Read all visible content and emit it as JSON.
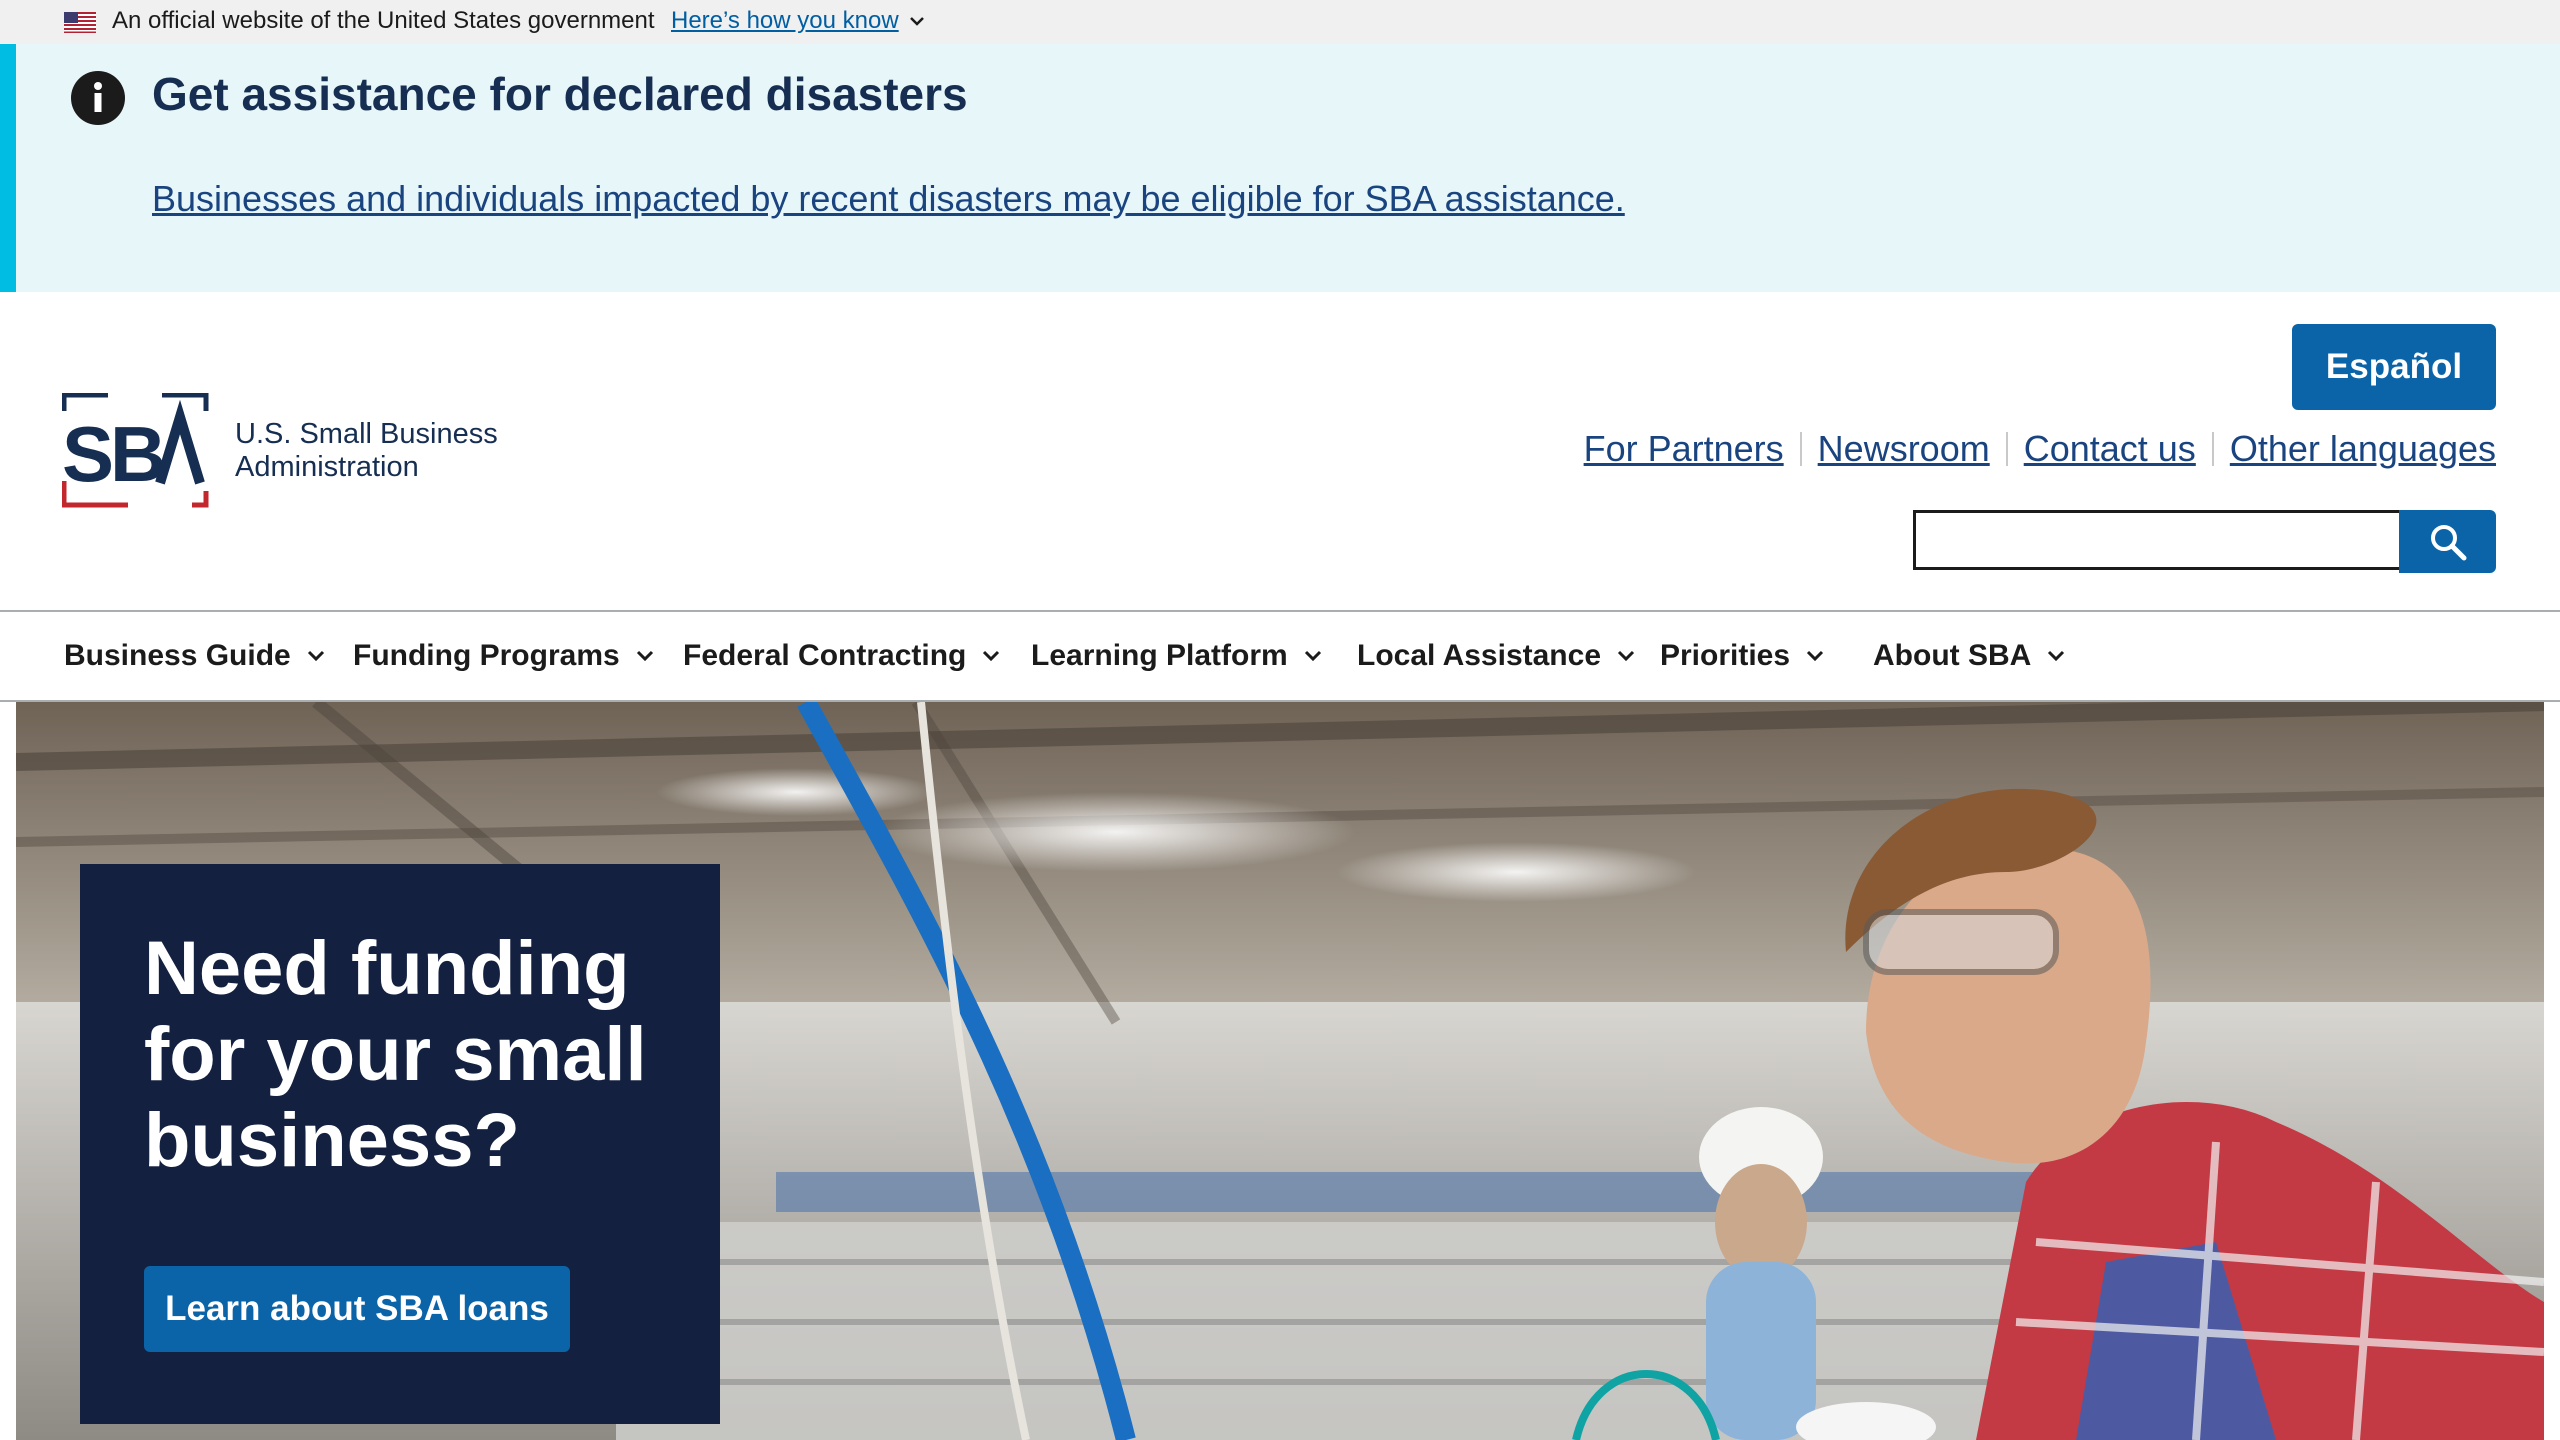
{
  "gov_banner": {
    "text": "An official website of the United States government",
    "link": "Here’s how you know"
  },
  "alert": {
    "heading": "Get assistance for declared disasters",
    "link": "Businesses and individuals impacted by recent disasters may be eligible for SBA assistance."
  },
  "header": {
    "logo_text_line1": "U.S. Small Business",
    "logo_text_line2": "Administration",
    "espanol_label": "Español",
    "util_links": [
      "For Partners",
      "Newsroom",
      "Contact us",
      "Other languages"
    ],
    "search_placeholder": ""
  },
  "nav": {
    "items": [
      "Business Guide",
      "Funding Programs",
      "Federal Contracting",
      "Learning Platform",
      "Local Assistance",
      "Priorities",
      "About SBA"
    ]
  },
  "hero": {
    "title": "Need funding for your small business?",
    "button_label": "Learn about SBA loans"
  },
  "colors": {
    "primary": "#0b64a8",
    "navy": "#162e51",
    "hero_card": "#13203f",
    "alert_bg": "#e7f6f8",
    "alert_bar": "#00bde3"
  },
  "icons": [
    "us-flag-icon",
    "chevron-down-icon",
    "info-icon",
    "search-icon"
  ]
}
